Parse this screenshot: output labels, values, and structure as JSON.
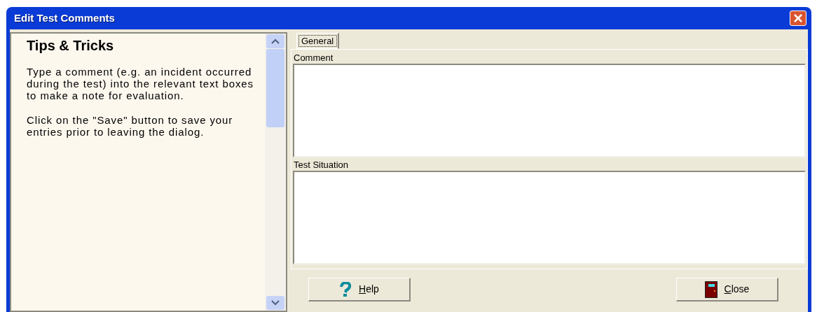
{
  "window": {
    "title": "Edit Test Comments"
  },
  "tips": {
    "heading": "Tips & Tricks",
    "paragraphs": [
      "Type a comment (e.g. an incident occurred during the test) into the relevant text boxes to make a note for evaluation.",
      "Click on the \"Save\" button to save your entries prior to leaving the dialog."
    ]
  },
  "tabs": [
    {
      "label": "General",
      "selected": true
    }
  ],
  "fields": [
    {
      "label": "Comment"
    },
    {
      "label": "Test Situation"
    }
  ],
  "buttons": [
    {
      "kind": "help",
      "label": "Help"
    },
    {
      "kind": "close",
      "label": "Close"
    }
  ]
}
